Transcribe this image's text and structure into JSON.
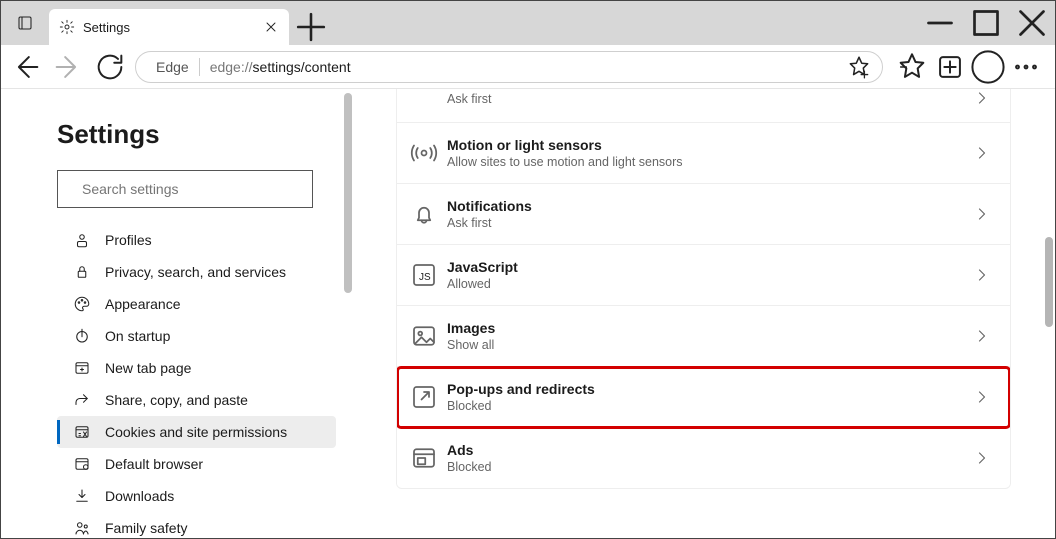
{
  "tab": {
    "title": "Settings"
  },
  "address": {
    "app_name": "Edge",
    "url_prefix": "edge://",
    "url_path": "settings/content"
  },
  "sidebar": {
    "title": "Settings",
    "search_placeholder": "Search settings",
    "items": [
      {
        "label": "Profiles",
        "name": "sidebar-item-profiles"
      },
      {
        "label": "Privacy, search, and services",
        "name": "sidebar-item-privacy"
      },
      {
        "label": "Appearance",
        "name": "sidebar-item-appearance"
      },
      {
        "label": "On startup",
        "name": "sidebar-item-startup"
      },
      {
        "label": "New tab page",
        "name": "sidebar-item-newtab"
      },
      {
        "label": "Share, copy, and paste",
        "name": "sidebar-item-share"
      },
      {
        "label": "Cookies and site permissions",
        "name": "sidebar-item-cookies",
        "active": true
      },
      {
        "label": "Default browser",
        "name": "sidebar-item-default-browser"
      },
      {
        "label": "Downloads",
        "name": "sidebar-item-downloads"
      },
      {
        "label": "Family safety",
        "name": "sidebar-item-family"
      }
    ]
  },
  "permissions": [
    {
      "title": "",
      "sub": "Ask first",
      "icon": "",
      "name": "perm-mic",
      "top": true
    },
    {
      "title": "Motion or light sensors",
      "sub": "Allow sites to use motion and light sensors",
      "icon": "sensor",
      "name": "perm-sensors"
    },
    {
      "title": "Notifications",
      "sub": "Ask first",
      "icon": "bell",
      "name": "perm-notifications"
    },
    {
      "title": "JavaScript",
      "sub": "Allowed",
      "icon": "js",
      "name": "perm-javascript"
    },
    {
      "title": "Images",
      "sub": "Show all",
      "icon": "image",
      "name": "perm-images"
    },
    {
      "title": "Pop-ups and redirects",
      "sub": "Blocked",
      "icon": "popup",
      "name": "perm-popups",
      "highlight": true
    },
    {
      "title": "Ads",
      "sub": "Blocked",
      "icon": "ads",
      "name": "perm-ads"
    }
  ]
}
